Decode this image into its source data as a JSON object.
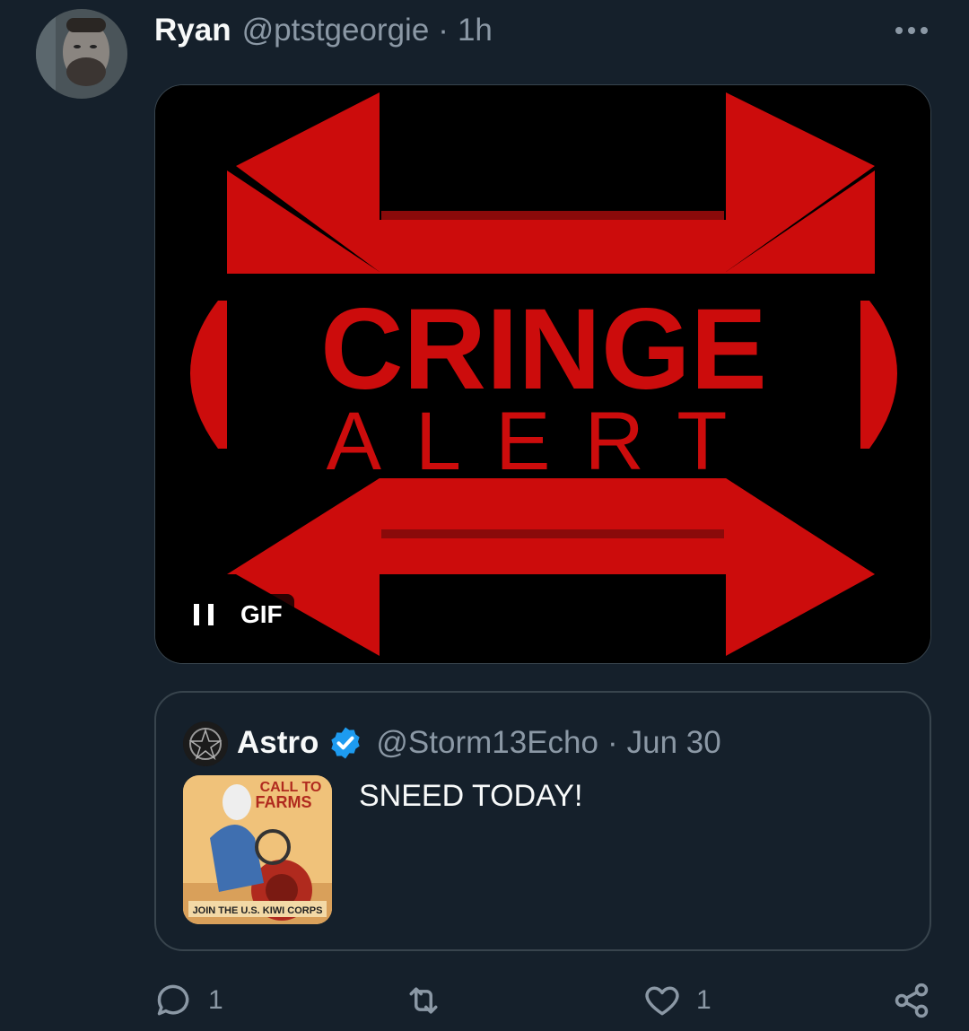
{
  "tweet": {
    "display_name": "Ryan",
    "handle": "@ptstgeorgie",
    "separator": "·",
    "time": "1h",
    "avatar_icon": "user-avatar",
    "more_icon": "more-horizontal-icon"
  },
  "media": {
    "image_text_line1": "CRINGE",
    "image_text_line2": "ALERT",
    "gif_label": "GIF",
    "state_icon": "pause-icon",
    "accent_color": "#cc0c0c"
  },
  "quote": {
    "display_name": "Astro",
    "verified_icon": "verified-badge-icon",
    "handle": "@Storm13Echo",
    "separator": "·",
    "time": "Jun 30",
    "text": "SNEED TODAY!",
    "thumb_text_top": "CALL TO",
    "thumb_text_mid": "FARMS",
    "thumb_text_bottom": "JOIN THE U.S. KIWI CORPS"
  },
  "actions": {
    "reply_count": "1",
    "retweet_count": "",
    "like_count": "1"
  },
  "colors": {
    "background": "#15202b",
    "secondary_text": "#8b98a5",
    "verified": "#1d9bf0"
  }
}
